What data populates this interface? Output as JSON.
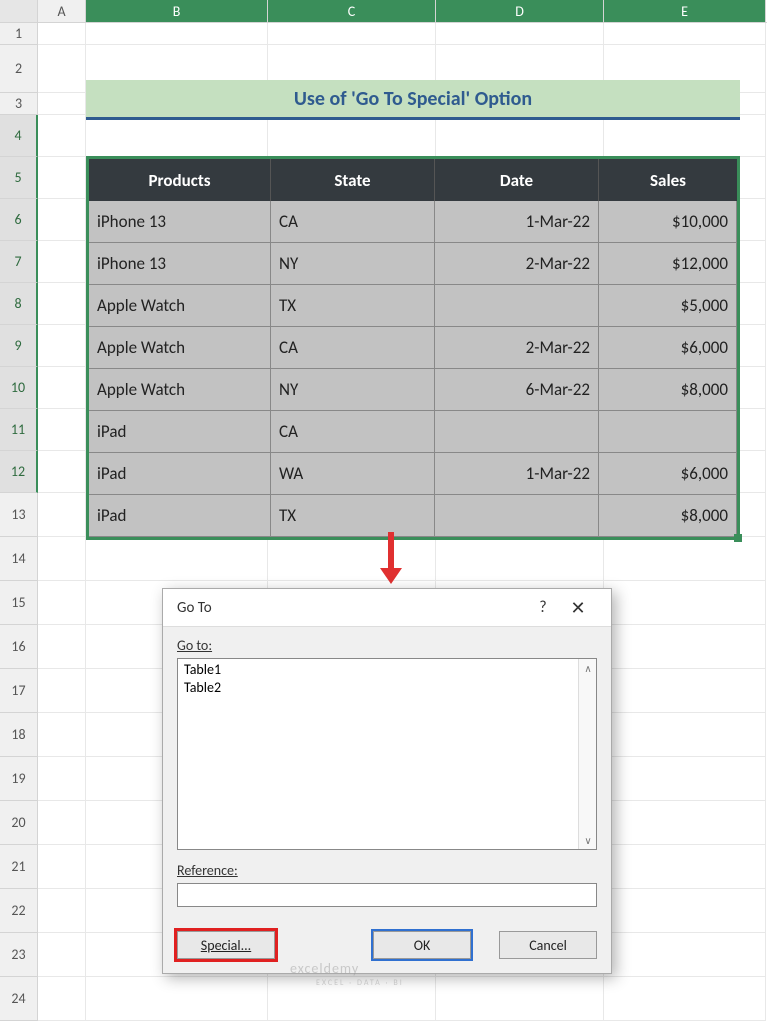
{
  "columns": [
    "A",
    "B",
    "C",
    "D",
    "E"
  ],
  "rows": [
    "1",
    "2",
    "3",
    "4",
    "5",
    "6",
    "7",
    "8",
    "9",
    "10",
    "11",
    "12",
    "13",
    "14",
    "15",
    "16",
    "17",
    "18",
    "19",
    "20",
    "21",
    "22",
    "23",
    "24"
  ],
  "title": "Use of 'Go To Special' Option",
  "table": {
    "headers": [
      "Products",
      "State",
      "Date",
      "Sales"
    ],
    "rows": [
      {
        "product": "iPhone 13",
        "state": "CA",
        "date": "1-Mar-22",
        "sales": "$10,000"
      },
      {
        "product": "iPhone 13",
        "state": "NY",
        "date": "2-Mar-22",
        "sales": "$12,000"
      },
      {
        "product": "Apple Watch",
        "state": "TX",
        "date": "",
        "sales": "$5,000"
      },
      {
        "product": "Apple Watch",
        "state": "CA",
        "date": "2-Mar-22",
        "sales": "$6,000"
      },
      {
        "product": "Apple Watch",
        "state": "NY",
        "date": "6-Mar-22",
        "sales": "$8,000"
      },
      {
        "product": "iPad",
        "state": "CA",
        "date": "",
        "sales": ""
      },
      {
        "product": "iPad",
        "state": "WA",
        "date": "1-Mar-22",
        "sales": "$6,000"
      },
      {
        "product": "iPad",
        "state": "TX",
        "date": "",
        "sales": "$8,000"
      }
    ]
  },
  "dialog": {
    "title": "Go To",
    "goto_label": "Go to:",
    "list": [
      "Table1",
      "Table2"
    ],
    "reference_label": "Reference:",
    "reference_value": "",
    "buttons": {
      "special": "Special...",
      "ok": "OK",
      "cancel": "Cancel"
    }
  },
  "watermark": "exceldemy",
  "watermark_sub": "EXCEL · DATA · BI",
  "chart_data": {
    "type": "table",
    "title": "Use of 'Go To Special' Option",
    "columns": [
      "Products",
      "State",
      "Date",
      "Sales"
    ],
    "rows": [
      [
        "iPhone 13",
        "CA",
        "1-Mar-22",
        10000
      ],
      [
        "iPhone 13",
        "NY",
        "2-Mar-22",
        12000
      ],
      [
        "Apple Watch",
        "TX",
        null,
        5000
      ],
      [
        "Apple Watch",
        "CA",
        "2-Mar-22",
        6000
      ],
      [
        "Apple Watch",
        "NY",
        "6-Mar-22",
        8000
      ],
      [
        "iPad",
        "CA",
        null,
        null
      ],
      [
        "iPad",
        "WA",
        "1-Mar-22",
        6000
      ],
      [
        "iPad",
        "TX",
        null,
        8000
      ]
    ]
  }
}
